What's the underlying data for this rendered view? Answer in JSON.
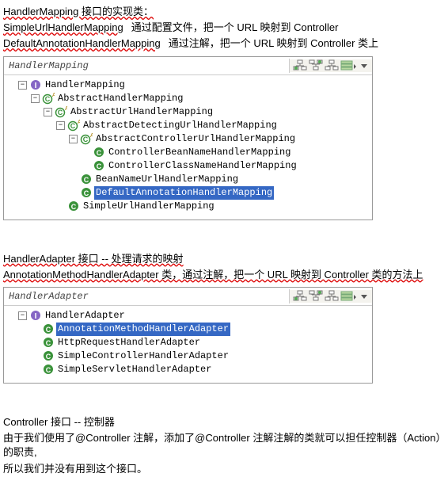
{
  "text": {
    "hm_intro": "HandlerMapping 接口的实现类：",
    "hm_simpleurl": "SimpleUrlHandlerMapping",
    "hm_simpleurl_desc": "通过配置文件，把一个 URL 映射到 Controller",
    "hm_defaultanno": "DefaultAnnotationHandlerMapping",
    "hm_defaultanno_desc": "通过注解，把一个 URL 映射到 Controller 类上",
    "ha_intro": "HandlerAdapter 接口 -- 处理请求的映射",
    "ha_anno": "AnnotationMethodHandlerAdapter 类，通过注解，把一个 URL 映射到 Controller 类的方法上",
    "ctrl_title": "Controller 接口 -- 控制器",
    "ctrl_p1": "由于我们使用了@Controller 注解，添加了@Controller 注解注解的类就可以担任控制器（Action）的职责,",
    "ctrl_p2": "所以我们并没有用到这个接口。"
  },
  "panel1": {
    "title": "HandlerMapping",
    "tree": {
      "n0": "HandlerMapping",
      "n1": "AbstractHandlerMapping",
      "n2": "AbstractUrlHandlerMapping",
      "n3": "AbstractDetectingUrlHandlerMapping",
      "n4": "AbstractControllerUrlHandlerMapping",
      "n5": "ControllerBeanNameHandlerMapping",
      "n6": "ControllerClassNameHandlerMapping",
      "n7": "BeanNameUrlHandlerMapping",
      "n8": "DefaultAnnotationHandlerMapping",
      "n9": "SimpleUrlHandlerMapping"
    }
  },
  "panel2": {
    "title": "HandlerAdapter",
    "tree": {
      "n0": "HandlerAdapter",
      "n1": "AnnotationMethodHandlerAdapter",
      "n2": "HttpRequestHandlerAdapter",
      "n3": "SimpleControllerHandlerAdapter",
      "n4": "SimpleServletHandlerAdapter"
    }
  }
}
